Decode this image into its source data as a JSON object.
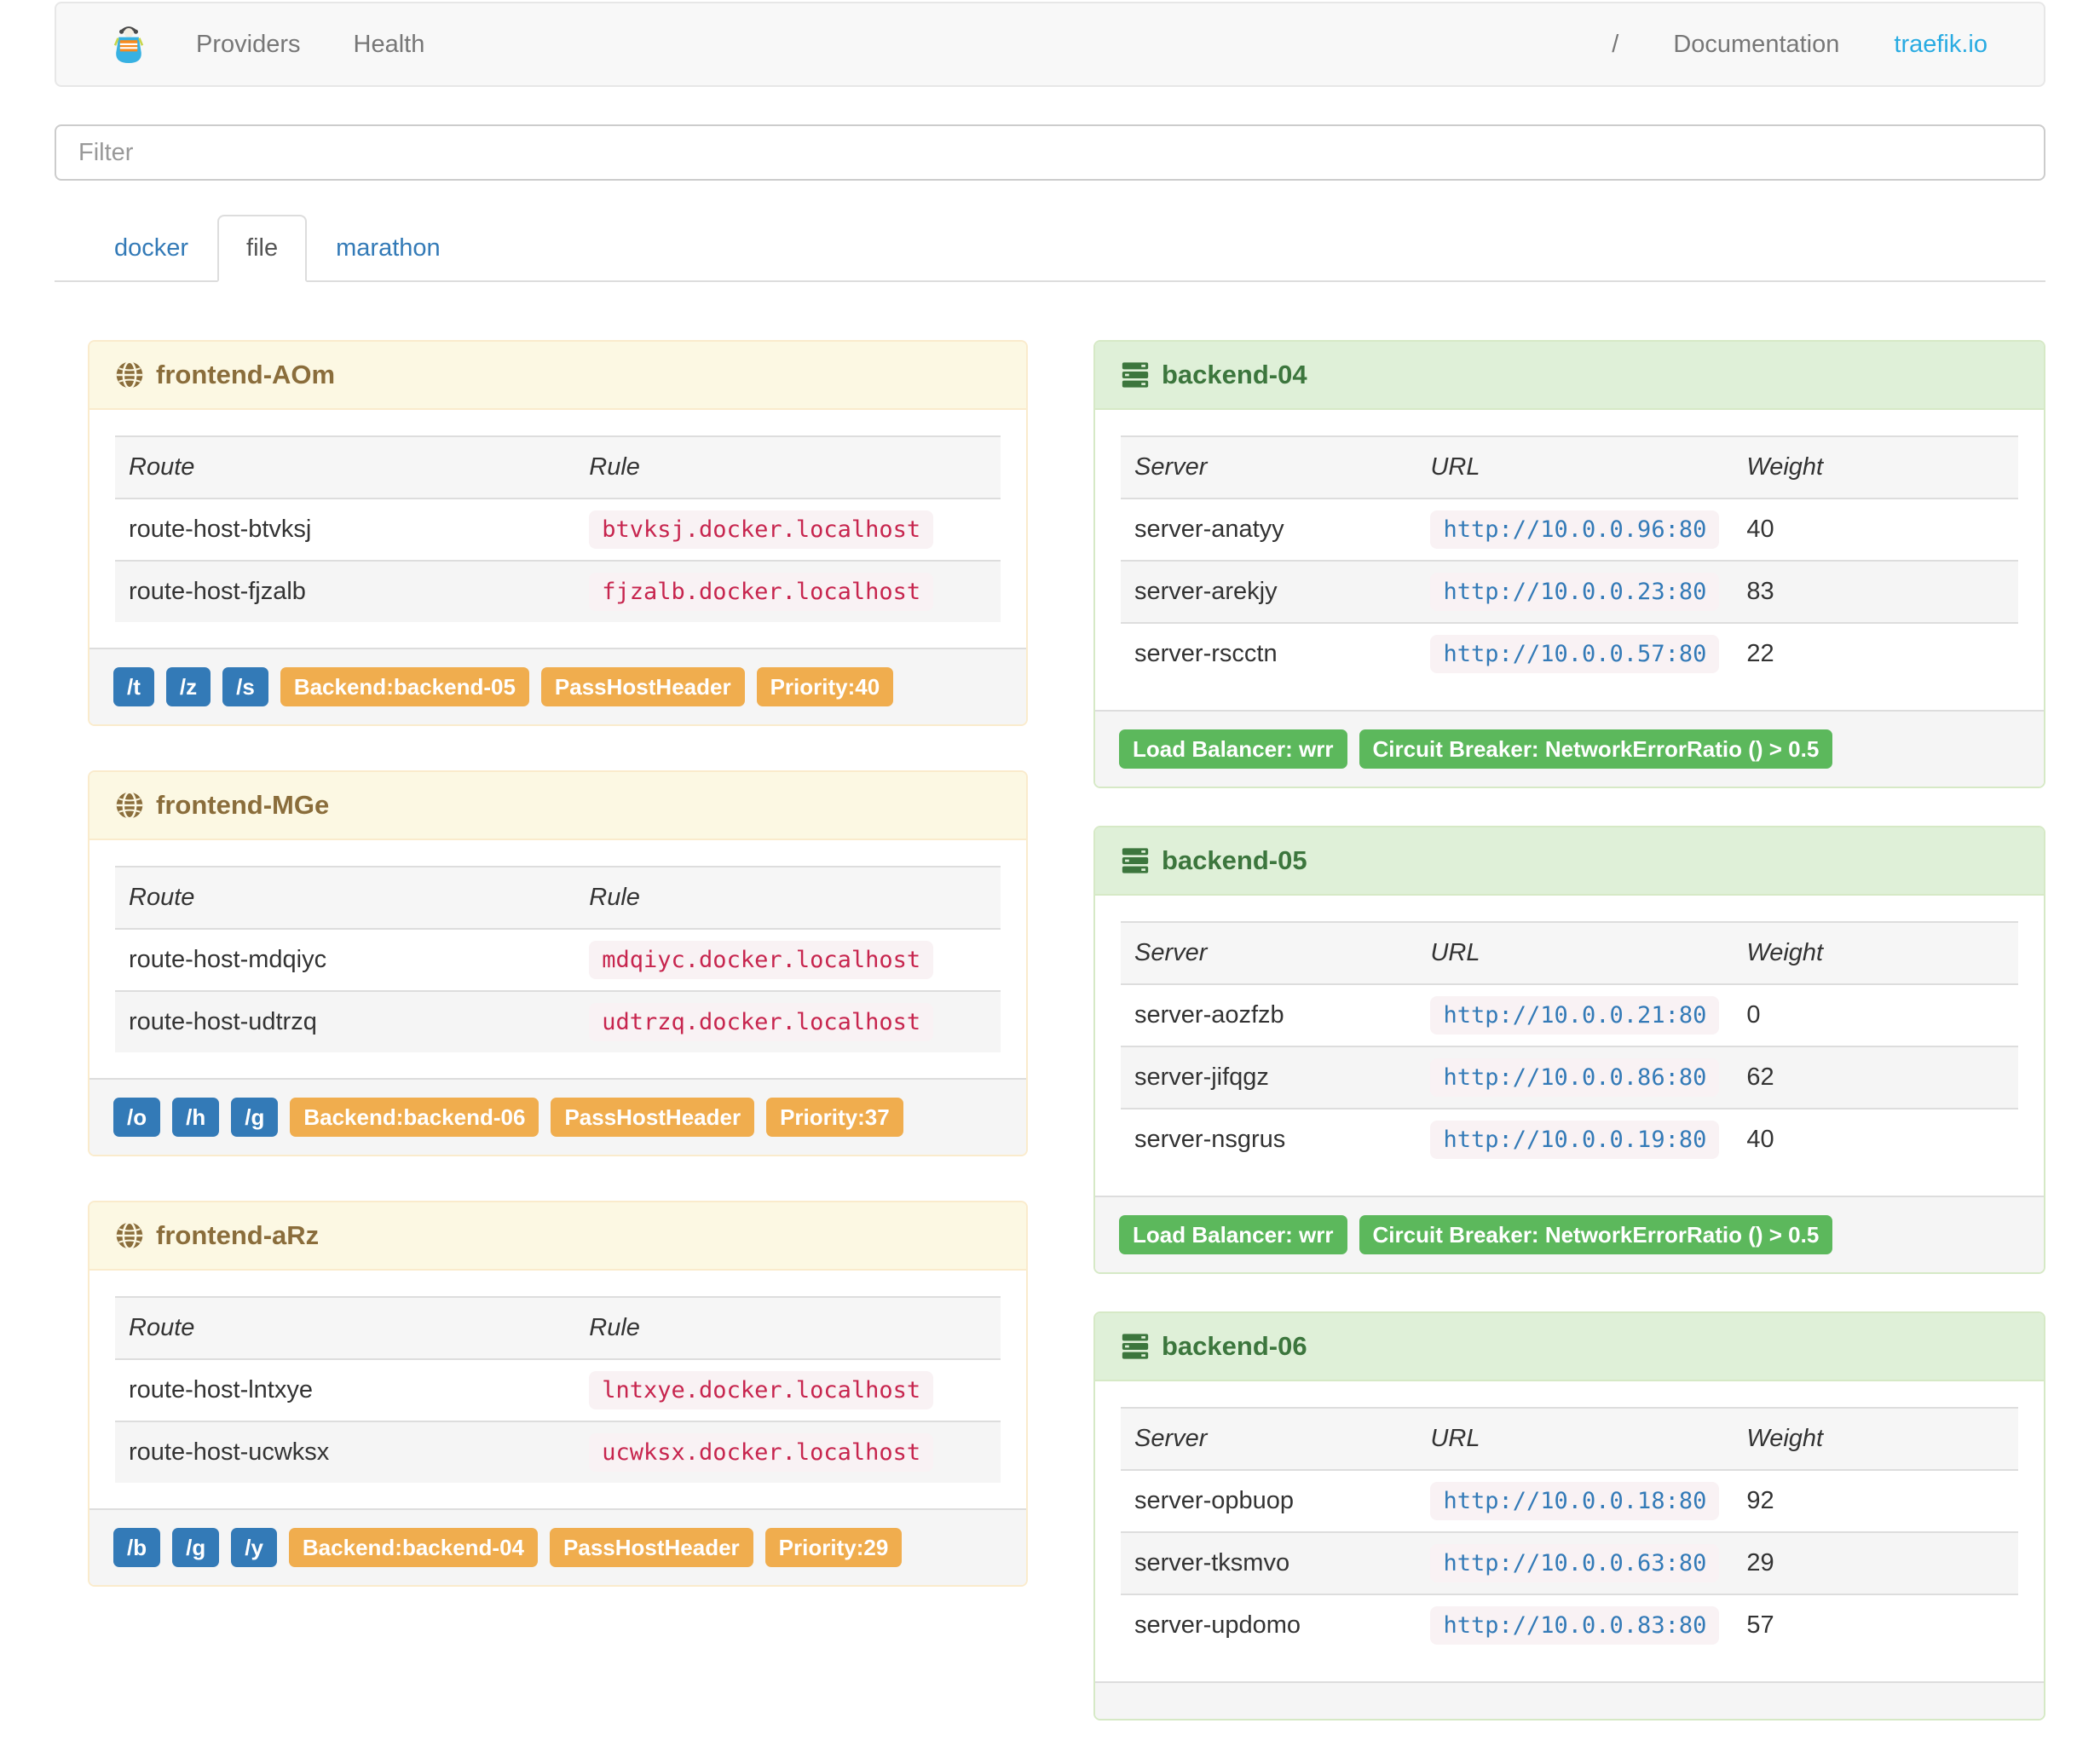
{
  "navbar": {
    "brand_icon": "traefik-logo",
    "providers_label": "Providers",
    "health_label": "Health",
    "slash_label": "/",
    "documentation_label": "Documentation",
    "site_label": "traefik.io"
  },
  "filter": {
    "placeholder": "Filter"
  },
  "tabs": [
    {
      "label": "docker",
      "state": "inactive"
    },
    {
      "label": "file",
      "state": "active"
    },
    {
      "label": "marathon",
      "state": "inactive"
    }
  ],
  "colors": {
    "primary_badge": "#337ab7",
    "warning_badge": "#f0ad4e",
    "success_badge": "#5cb85c",
    "frontend_header_bg": "#fcf8e3",
    "frontend_header_text": "#8a6d3b",
    "backend_header_bg": "#dff0d8",
    "backend_header_text": "#3c763d",
    "rule_code_text": "#c7254e",
    "url_code_text": "#337ab7",
    "site_link": "#29abe2"
  },
  "frontends": [
    {
      "title": "frontend-AOm",
      "columns": [
        "Route",
        "Rule"
      ],
      "routes": [
        {
          "route": "route-host-btvksj",
          "rule": "btvksj.docker.localhost"
        },
        {
          "route": "route-host-fjzalb",
          "rule": "fjzalb.docker.localhost"
        }
      ],
      "route_badges": [
        "/t",
        "/z",
        "/s"
      ],
      "badges": [
        "Backend:backend-05",
        "PassHostHeader",
        "Priority:40"
      ]
    },
    {
      "title": "frontend-MGe",
      "columns": [
        "Route",
        "Rule"
      ],
      "routes": [
        {
          "route": "route-host-mdqiyc",
          "rule": "mdqiyc.docker.localhost"
        },
        {
          "route": "route-host-udtrzq",
          "rule": "udtrzq.docker.localhost"
        }
      ],
      "route_badges": [
        "/o",
        "/h",
        "/g"
      ],
      "badges": [
        "Backend:backend-06",
        "PassHostHeader",
        "Priority:37"
      ]
    },
    {
      "title": "frontend-aRz",
      "columns": [
        "Route",
        "Rule"
      ],
      "routes": [
        {
          "route": "route-host-lntxye",
          "rule": "lntxye.docker.localhost"
        },
        {
          "route": "route-host-ucwksx",
          "rule": "ucwksx.docker.localhost"
        }
      ],
      "route_badges": [
        "/b",
        "/g",
        "/y"
      ],
      "badges": [
        "Backend:backend-04",
        "PassHostHeader",
        "Priority:29"
      ]
    }
  ],
  "backends": [
    {
      "title": "backend-04",
      "columns": [
        "Server",
        "URL",
        "Weight"
      ],
      "servers": [
        {
          "server": "server-anatyy",
          "url": "http://10.0.0.96:80",
          "weight": "40"
        },
        {
          "server": "server-arekjy",
          "url": "http://10.0.0.23:80",
          "weight": "83"
        },
        {
          "server": "server-rscctn",
          "url": "http://10.0.0.57:80",
          "weight": "22"
        }
      ],
      "badges": [
        "Load Balancer: wrr",
        "Circuit Breaker: NetworkErrorRatio () > 0.5"
      ]
    },
    {
      "title": "backend-05",
      "columns": [
        "Server",
        "URL",
        "Weight"
      ],
      "servers": [
        {
          "server": "server-aozfzb",
          "url": "http://10.0.0.21:80",
          "weight": "0"
        },
        {
          "server": "server-jifqgz",
          "url": "http://10.0.0.86:80",
          "weight": "62"
        },
        {
          "server": "server-nsgrus",
          "url": "http://10.0.0.19:80",
          "weight": "40"
        }
      ],
      "badges": [
        "Load Balancer: wrr",
        "Circuit Breaker: NetworkErrorRatio () > 0.5"
      ]
    },
    {
      "title": "backend-06",
      "columns": [
        "Server",
        "URL",
        "Weight"
      ],
      "servers": [
        {
          "server": "server-opbuop",
          "url": "http://10.0.0.18:80",
          "weight": "92"
        },
        {
          "server": "server-tksmvo",
          "url": "http://10.0.0.63:80",
          "weight": "29"
        },
        {
          "server": "server-updomo",
          "url": "http://10.0.0.83:80",
          "weight": "57"
        }
      ],
      "badges": []
    }
  ]
}
